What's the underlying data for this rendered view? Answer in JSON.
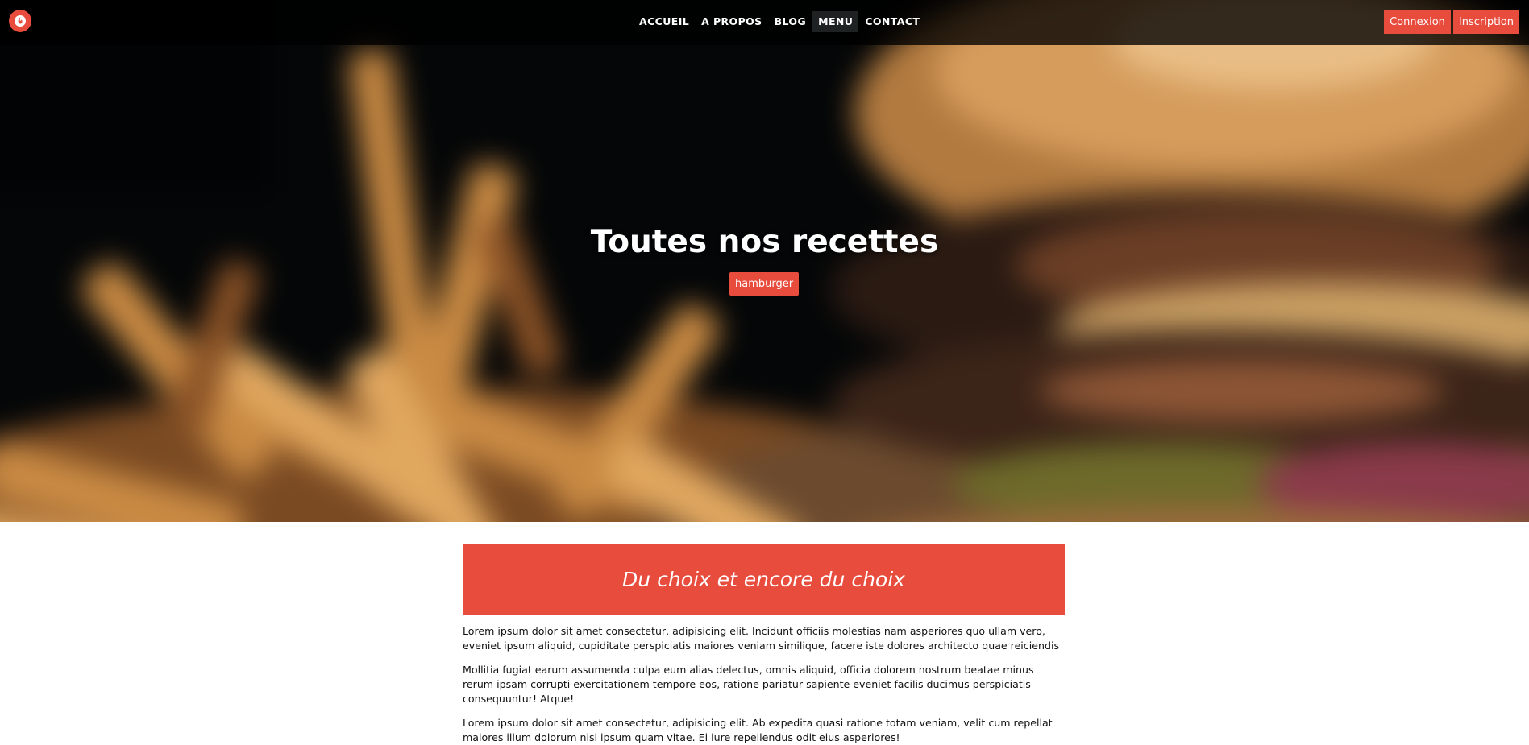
{
  "navbar": {
    "logo_icon": "flame-logo-icon",
    "links": [
      {
        "label": "ACCUEIL"
      },
      {
        "label": "A PROPOS"
      },
      {
        "label": "BLOG"
      },
      {
        "label": "MENU",
        "active": true
      },
      {
        "label": "CONTACT"
      }
    ],
    "login_label": "Connexion",
    "signup_label": "Inscription"
  },
  "hero": {
    "title": "Toutes nos recettes",
    "tag": "hamburger"
  },
  "main": {
    "banner_title": "Du choix et encore du choix",
    "paragraphs": [
      "Lorem ipsum dolor sit amet consectetur, adipisicing elit. Incidunt officiis molestias nam asperiores quo ullam vero, eveniet ipsum aliquid, cupiditate perspiciatis maiores veniam similique, facere iste dolores architecto quae reiciendis",
      "Mollitia fugiat earum assumenda culpa eum alias delectus, omnis aliquid, officia dolorem nostrum beatae minus rerum ipsam corrupti exercitationem tempore eos, ratione pariatur sapiente eveniet facilis ducimus perspiciatis consequuntur! Atque!",
      "Lorem ipsum dolor sit amet consectetur, adipisicing elit. Ab expedita quasi ratione totam veniam, velit cum repellat maiores illum dolorum nisi ipsum quam vitae. Ei iure repellendus odit eius asperiores!"
    ]
  },
  "colors": {
    "accent": "#e84c3d",
    "navbar_bg": "#000000",
    "text": "#111111"
  }
}
